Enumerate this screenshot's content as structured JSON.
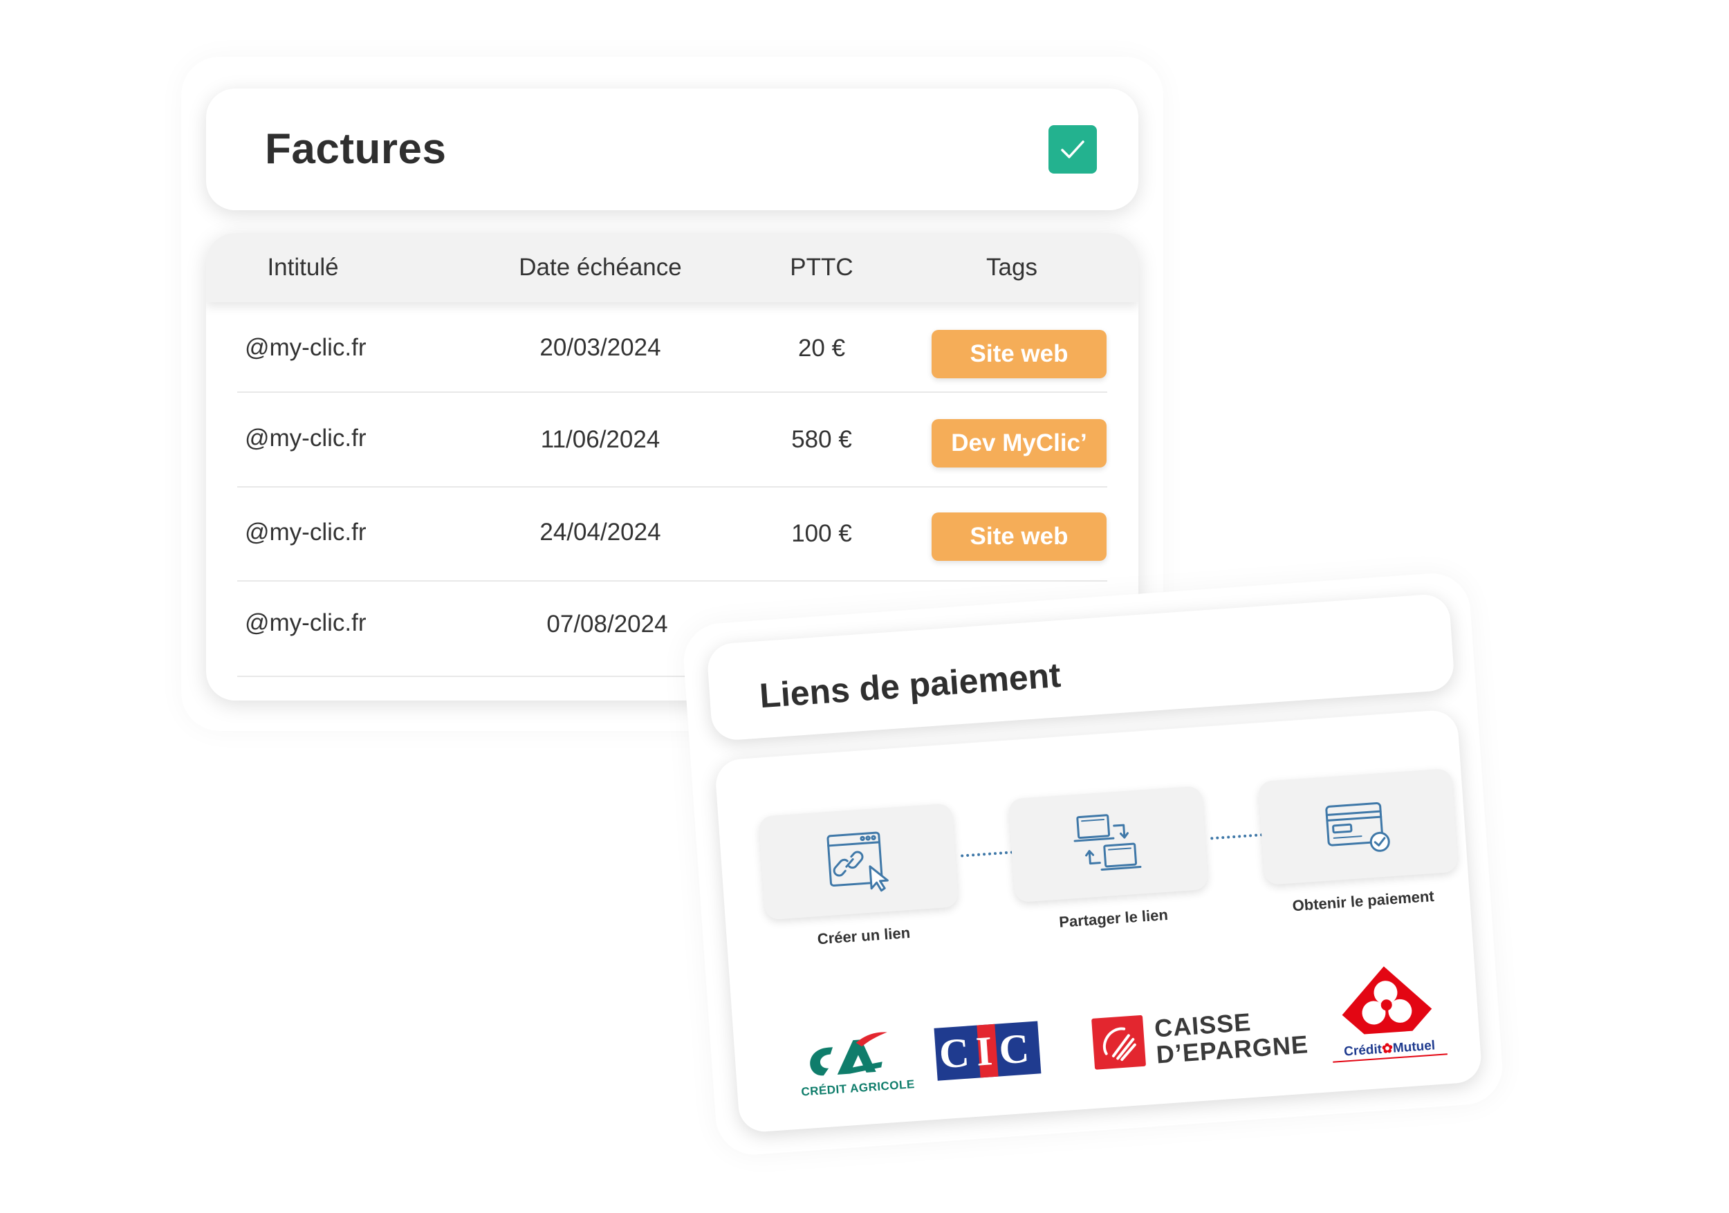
{
  "factures": {
    "title": "Factures",
    "columns": [
      "Intitulé",
      "Date échéance",
      "PTTC",
      "Tags"
    ],
    "rows": [
      {
        "intitule": "@my-clic.fr",
        "date": "20/03/2024",
        "pttc": "20 €",
        "tag": "Site web"
      },
      {
        "intitule": "@my-clic.fr",
        "date": "11/06/2024",
        "pttc": "580 €",
        "tag": "Dev MyClic’"
      },
      {
        "intitule": "@my-clic.fr",
        "date": "24/04/2024",
        "pttc": "100 €",
        "tag": "Site web"
      },
      {
        "intitule": "@my-clic.fr",
        "date": "07/08/2024",
        "pttc": "",
        "tag": ""
      }
    ]
  },
  "liens": {
    "title": "Liens de paiement",
    "steps": [
      {
        "label": "Créer un lien",
        "icon": "link-window-icon"
      },
      {
        "label": "Partager le lien",
        "icon": "share-computers-icon"
      },
      {
        "label": "Obtenir le paiement",
        "icon": "credit-card-check-icon"
      }
    ],
    "banks": {
      "ca_name": "CRÉDIT AGRICOLE",
      "cic_name": "CIC",
      "ce_line1": "CAISSE",
      "ce_line2": "D’EPARGNE",
      "cm_name1": "Crédit",
      "cm_name2": "Mutuel"
    }
  },
  "colors": {
    "accent_green": "#23b28f",
    "tag_orange": "#f5ad58",
    "icon_blue": "#3f78a8",
    "ca_green": "#0f7d6b",
    "cic_blue": "#1f3b8f",
    "ce_red": "#e3262f",
    "cm_red": "#e30613"
  }
}
